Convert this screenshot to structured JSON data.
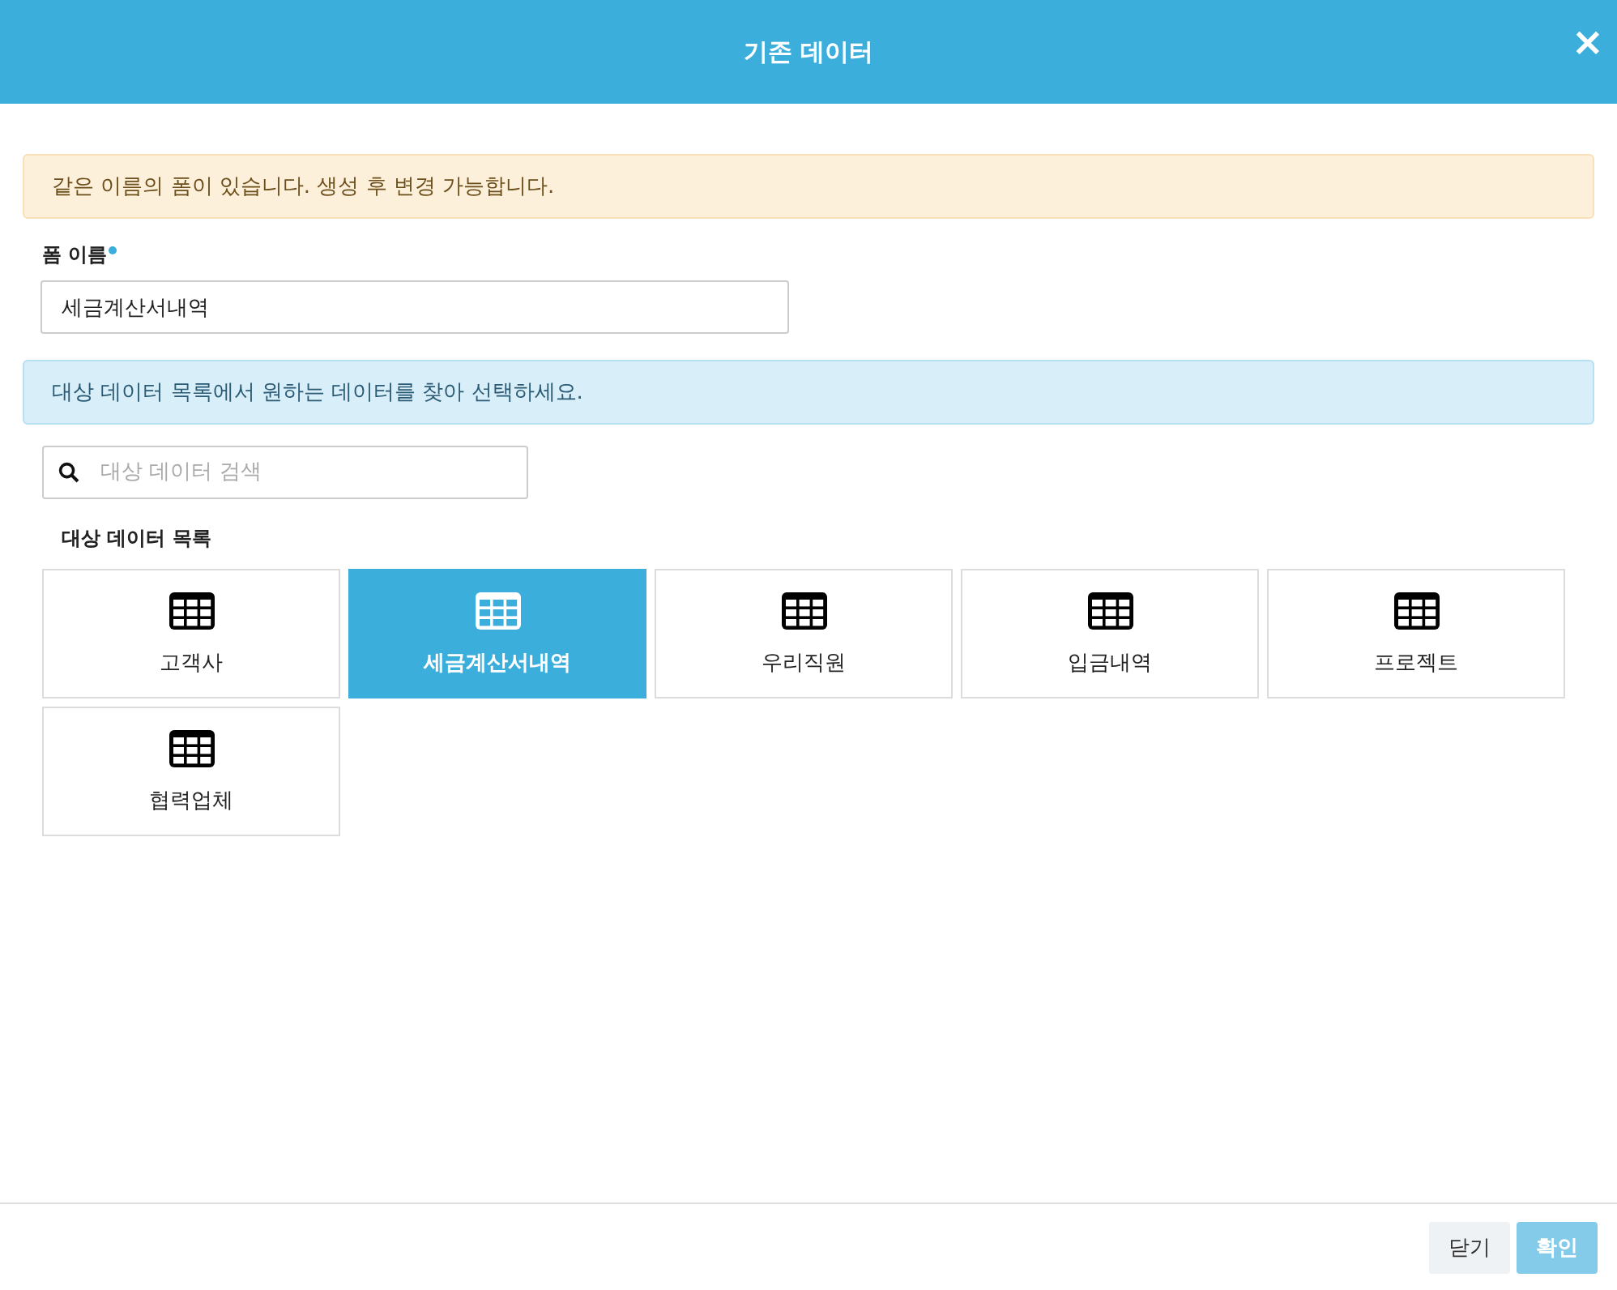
{
  "window": {
    "title": "기존 데이터",
    "close": "×"
  },
  "warning": "같은 이름의 폼이 있습니다. 생성 후 변경 가능합니다.",
  "form_name": {
    "label": "폼 이름",
    "required": true,
    "value": "세금계산서내역"
  },
  "info": "대상 데이터 목록에서 원하는 데이터를 찾아 선택하세요.",
  "search": {
    "placeholder": "대상 데이터 검색"
  },
  "list": {
    "title": "대상 데이터 목록",
    "items": [
      {
        "label": "고객사",
        "selected": false
      },
      {
        "label": "세금계산서내역",
        "selected": true
      },
      {
        "label": "우리직원",
        "selected": false
      },
      {
        "label": "입금내역",
        "selected": false
      },
      {
        "label": "프로젝트",
        "selected": false
      },
      {
        "label": "협력업체",
        "selected": false
      }
    ]
  },
  "buttons": [
    {
      "label": "닫기",
      "kind": "secondary",
      "disabled": false
    },
    {
      "label": "확인",
      "kind": "primary",
      "disabled": true
    }
  ]
}
